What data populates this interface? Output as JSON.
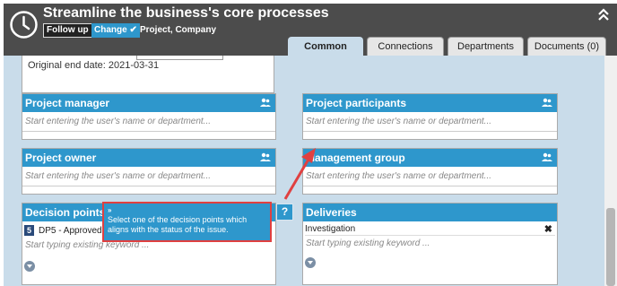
{
  "header": {
    "title": "Streamline the business's core processes",
    "follow_up_label": "Follow up",
    "change_label": "Change",
    "subtitle": "Project, Company"
  },
  "tabs": [
    {
      "label": "Common",
      "active": true
    },
    {
      "label": "Connections",
      "active": false
    },
    {
      "label": "Departments",
      "active": false
    },
    {
      "label": "Documents (0)",
      "active": false
    }
  ],
  "top": {
    "original_end_date": "Original end date: 2021-03-31"
  },
  "panels": {
    "project_manager": {
      "title": "Project manager",
      "placeholder": "Start entering the user's name or department..."
    },
    "project_participants": {
      "title": "Project participants",
      "placeholder": "Start entering the user's name or department..."
    },
    "project_owner": {
      "title": "Project owner",
      "placeholder": "Start entering the user's name or department..."
    },
    "management_group": {
      "title": "Management group",
      "placeholder": "Start entering the user's name or department..."
    },
    "decision_points": {
      "title": "Decision points",
      "item_number": "5",
      "item_text": "DP5 - Approved c",
      "keyword_placeholder": "Start typing existing keyword ..."
    },
    "deliveries": {
      "title": "Deliveries",
      "item_text": "Investigation",
      "keyword_placeholder": "Start typing existing keyword ..."
    }
  },
  "tooltip": {
    "text": "Select one of the decision points which aligns with the status of the issue."
  },
  "help_button_label": "?",
  "colors": {
    "header_bg": "#4c4c4c",
    "accent": "#2e97cc",
    "content_bg": "#c9dcea",
    "annotation": "#e04040"
  }
}
